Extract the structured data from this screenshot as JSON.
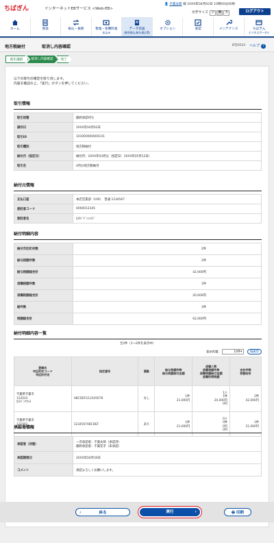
{
  "header": {
    "logo": "ちばぎん",
    "service": "インターネットEBサービス <Web-EB>",
    "user_name": "千葉太郎",
    "user_suffix": "様",
    "last_login": "20XX年04月02日 10時00分00秒",
    "font_size_label": "文字サイズ",
    "font_sizes": [
      "小",
      "中",
      "大"
    ],
    "logout": "ログアウト"
  },
  "nav": [
    {
      "label": "ホーム",
      "sub": ""
    },
    {
      "label": "照会",
      "sub": ""
    },
    {
      "label": "振込・振替",
      "sub": ""
    },
    {
      "label": "税金・各種料金",
      "sub": "払込み"
    },
    {
      "label": "データ伝送",
      "sub": "(総合振込/給与振込等)"
    },
    {
      "label": "オプション",
      "sub": ""
    },
    {
      "label": "承認",
      "sub": ""
    },
    {
      "label": "メンテナンス",
      "sub": ""
    },
    {
      "label": "ちばぎん",
      "sub": "ビジネスポータル"
    }
  ],
  "page": {
    "title1": "地方税納付",
    "title2": "取消し内容確認",
    "screen_id": "BTJ5033",
    "help": "ヘルプ",
    "steps": [
      "取引選択",
      "取消し内容確認",
      "完了"
    ],
    "intro1": "以下の取引の確定を取り消します。",
    "intro2": "内容を確認の上、「実行」ボタンを押してください。"
  },
  "trade_info": {
    "title": "取引情報",
    "rows": [
      {
        "k": "取引状態",
        "v": "最終承認待ち"
      },
      {
        "k": "操作日",
        "v": "20XX年04月02日"
      },
      {
        "k": "取引ID",
        "v": "101000000000141"
      },
      {
        "k": "取引種別",
        "v": "地方税納付"
      },
      {
        "k": "納付月（指定日）",
        "v": "納付月：20XX年04月分（指定日：20XX年05月12日）"
      },
      {
        "k": "取引名",
        "v": "4月分地方税納付"
      }
    ]
  },
  "payer_info": {
    "title": "納付元情報",
    "rows": [
      {
        "k": "支払口座",
        "v": "本店営業部（100）　普通 1234567"
      },
      {
        "k": "委託者コード",
        "v": "0000012345"
      },
      {
        "k": "委託者名",
        "v": "ｶ)ﾁﾊﾞｷﾞﾝｼｮｳｼﾞ"
      }
    ]
  },
  "detail": {
    "title": "納付明細内容",
    "rows": [
      {
        "k": "納付市区町村数",
        "v": "2件"
      },
      {
        "k": "給与税額件数",
        "v": "2件"
      },
      {
        "k": "給与税額総合計",
        "v": "42,000円"
      },
      {
        "k": "退職税額件数",
        "v": "1件"
      },
      {
        "k": "退職税額総合計",
        "v": "20,000円"
      },
      {
        "k": "総件数",
        "v": "3件"
      },
      {
        "k": "税額総合計",
        "v": "62,000円"
      }
    ]
  },
  "list": {
    "title": "納付明細内容一覧",
    "count_text": "全2件（1～2件を表示中）",
    "per_page_label": "表示件数：",
    "per_page": "10件",
    "redisplay": "再表示",
    "headers": [
      "登録名\n市区町村コード\n市区町村名",
      "指定番号",
      "異動",
      "給与税額件数\n給与税額納付金額",
      "退職人数\n退職税額件数\n退職税額納付金額\n退職所得税額",
      "合計件数\n税額合計"
    ],
    "rows": [
      {
        "name": "千葉県千葉市",
        "code": "122033",
        "kana": "ｶ)ﾁﾊﾞｼﾔｸｼﾖ",
        "num": "ABCDEFG12345678",
        "change": "なし",
        "sal_cnt": "1件",
        "sal_amt": "21,000円",
        "ret_people": "1人",
        "ret_cnt": "1件",
        "ret_amt": "20,000円",
        "ret_tax": "0円",
        "tot_cnt": "2件",
        "tot_amt": "42,000円"
      },
      {
        "name": "千葉県千葉市",
        "code": "121002",
        "kana": "ｶ)ﾁﾊﾞｼﾔｸｼﾖ",
        "num": "1234567ABCDEF",
        "change": "あり",
        "sal_cnt": "1件",
        "sal_amt": "21,000円",
        "ret_people": "0人",
        "ret_cnt": "0件",
        "ret_amt": "0円",
        "ret_tax": "0円",
        "tot_cnt": "1件",
        "tot_amt": "21,000円"
      }
    ]
  },
  "approver": {
    "title": "承認者情報",
    "rows": [
      {
        "k": "承認者（状態）",
        "v1": "一次承認者：千葉太郎（承認済）",
        "v2": "最終承認者：千葉花子（未承認）"
      },
      {
        "k": "承認期限日",
        "v1": "20XX年04月30日",
        "v2": ""
      },
      {
        "k": "コメント",
        "v1": "承認よろしくお願いします。",
        "v2": ""
      }
    ]
  },
  "footer": {
    "back": "戻る",
    "exec": "実行",
    "print": "印刷"
  },
  "colors": {
    "brand_red": "#d8232a",
    "nav_blue": "#0b3f8e",
    "step_green": "#2a8a4a",
    "highlight_red": "#e0141e"
  }
}
